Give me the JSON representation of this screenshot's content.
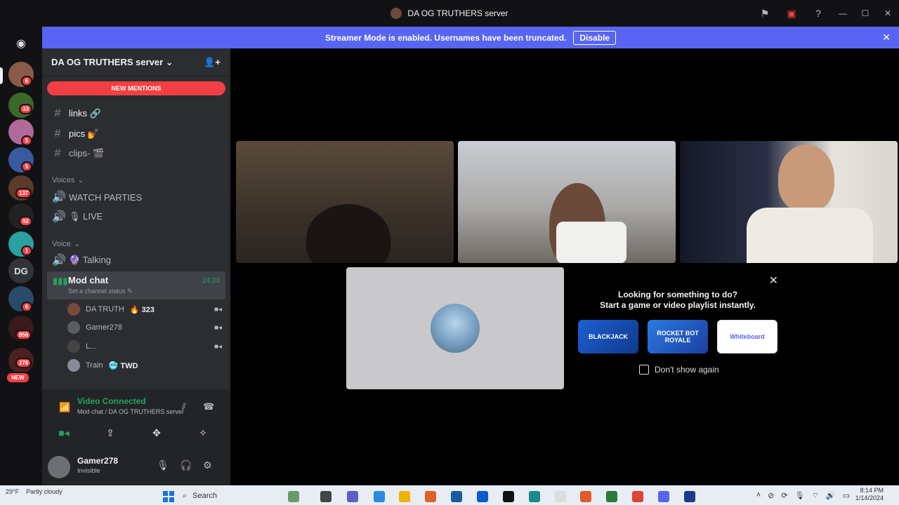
{
  "window": {
    "title": "DA OG TRUTHERS server"
  },
  "banner": {
    "text": "Streamer Mode is enabled. Usernames have been truncated.",
    "button": "Disable"
  },
  "serverbar": {
    "badges": [
      "6",
      "33",
      "5",
      "5",
      "137",
      "92",
      "1",
      "6",
      "856",
      "278"
    ],
    "dg_label": "DG",
    "new_label": "NEW"
  },
  "sidebar": {
    "server_name": "DA OG TRUTHERS server",
    "new_mentions": "NEW MENTIONS",
    "channels": [
      {
        "name": "links 🔗"
      },
      {
        "name": "pics 💅"
      },
      {
        "name": "clips- 🎬"
      }
    ],
    "categories": {
      "voices": "Voices",
      "voice": "Voice"
    },
    "voices_channels": [
      {
        "name": "WATCH PARTIES"
      },
      {
        "name": "🎙 LIVE"
      }
    ],
    "voice_channels": [
      {
        "name": "🔮 Talking"
      }
    ],
    "active_channel": {
      "name": "Mod chat",
      "status_placeholder": "Set a channel status ✎",
      "timer": "24:23"
    },
    "voice_users": [
      {
        "name": "DA TRUTH",
        "extra": "🔥 323"
      },
      {
        "name": "Gamer278",
        "extra": ""
      },
      {
        "name": "L...",
        "extra": ""
      },
      {
        "name": "Train",
        "extra": "🥶 TWD"
      }
    ]
  },
  "rtc": {
    "title": "Video Connected",
    "subtitle": "Mod chat / DA OG TRUTHERS server"
  },
  "user": {
    "name": "Gamer278",
    "status": "Invisible"
  },
  "activity": {
    "heading1": "Looking for something to do?",
    "heading2": "Start a game or video playlist instantly.",
    "games": [
      "BLACKJACK",
      "ROCKET BOT ROYALE",
      "Whiteboard"
    ],
    "dont_show": "Don't show again"
  },
  "taskbar": {
    "weather_temp": "29°F",
    "weather_desc": "Partly cloudy",
    "search_label": "Search",
    "time": "8:14 PM",
    "date": "1/14/2024"
  },
  "colors": {
    "brand": "#5865f2",
    "danger": "#f23f43",
    "online": "#23a55a"
  }
}
